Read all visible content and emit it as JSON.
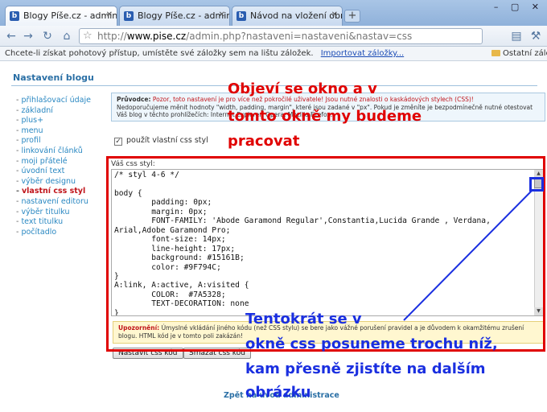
{
  "browser": {
    "tabs": [
      {
        "title": "Blogy Píše.cz - administr…",
        "active": true
      },
      {
        "title": "Blogy Píše.cz - administr…",
        "active": false
      },
      {
        "title": "Návod na vložení obrázk…",
        "active": false
      }
    ],
    "new_tab": "+",
    "window_controls": "– ▢ ✕",
    "url": {
      "scheme": "http://",
      "host": "www.pise.cz",
      "rest": "/admin.php?nastaveni=nastaveni&nastav=css"
    },
    "bookmark_prompt": "Chcete-li získat pohotový přístup, umístěte své záložky sem na lištu záložek.",
    "import_link": "Importovat záložky...",
    "other_bookmarks": "Ostatní záložky"
  },
  "page": {
    "title": "Nastavení blogu",
    "nav": [
      "přihlašovací údaje",
      "základní",
      "plus+",
      "menu",
      "profil",
      "linkování článků",
      "moji přátelé",
      "úvodní text",
      "výběr designu",
      "vlastní css styl",
      "nastavení editoru",
      "výběr titulku",
      "text titulku",
      "počítadlo"
    ],
    "active_nav": "vlastní css styl",
    "guide": {
      "lead": "Průvodce:",
      "warn": "Pozor, toto nastavení je pro více než pokročilé uživatele! Jsou nutné znalosti o kaskádových stylech (CSS)!",
      "text": "Nedoporučujeme měnit hodnoty \"width, padding, margin\", které jsou zadané v \"px\". Pokud je změníte je bezpodmínečně nutné otestovat Váš blog v těchto prohlížečích: Internet Explorer, Opera, Mozilla Firefox."
    },
    "use_css_checkbox": {
      "label": "použít vlastní css styl",
      "checked": true
    },
    "css_label": "Váš css styl:",
    "css_code": "/* styl 4-6 */\n\nbody {\n        padding: 0px;\n        margin: 0px;\n        FONT-FAMILY: 'Abode Garamond Regular',Constantia,Lucida Grande , Verdana,\nArial,Adobe Garamond Pro;\n        font-size: 14px;\n        line-height: 17px;\n        background: #15161B;\n        color: #9F794C;\n}\nA:link, A:active, A:visited {\n        COLOR:  #7A5328;\n        TEXT-DECORATION: none\n}",
    "warning": {
      "lead": "Upozornění:",
      "text": "Úmyslné vkládání jiného kódu (než CSS stylu) se bere jako vážné porušení pravidel a je důvodem k okamžitému zrušení blogu. HTML kód je v tomto poli zakázán!"
    },
    "buttons": {
      "save": "Nastavit css kód",
      "delete": "Smazat css kód"
    },
    "back_link": "Zpět na úvod administrace"
  },
  "annotations": {
    "top_text": [
      "Objeví se okno a v",
      "tomto okně my budeme",
      "pracovat"
    ],
    "bottom_text": [
      "Tentokrát se v",
      "okně css posuneme trochu níž,",
      "kam přesně zjistíte na dalším",
      "obrázku"
    ],
    "red": "#e00000",
    "blue": "#1a2fe0"
  }
}
